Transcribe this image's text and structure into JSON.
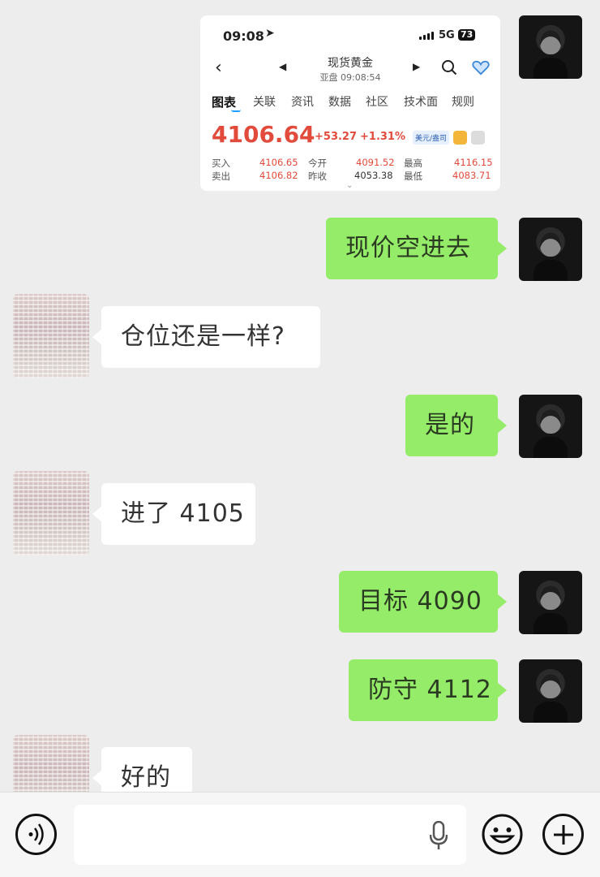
{
  "screenshot_card": {
    "status_time": "09:08",
    "status_location_arrow": "location-arrow-icon",
    "status_network": "5G",
    "status_battery": "73",
    "title": "现货黄金",
    "subtitle": "亚盘 09:08:54",
    "tabs": [
      "图表",
      "关联",
      "资讯",
      "数据",
      "社区",
      "技术面",
      "规则"
    ],
    "active_tab": "图表",
    "price": "4106.64",
    "change": "+53.27",
    "change_pct": "+1.31%",
    "currency_badge": "美元/盎司",
    "quotes": {
      "buy_label": "买入",
      "buy_value": "4106.65",
      "sell_label": "卖出",
      "sell_value": "4106.82",
      "open_label": "今开",
      "open_value": "4091.52",
      "prev_close_label": "昨收",
      "prev_close_value": "4053.38",
      "high_label": "最高",
      "high_value": "4116.15",
      "low_label": "最低",
      "low_value": "4083.71"
    }
  },
  "messages": [
    {
      "side": "self",
      "text": "现价空进去"
    },
    {
      "side": "other",
      "text": "仓位还是一样?"
    },
    {
      "side": "self",
      "text": "是的"
    },
    {
      "side": "other",
      "text": "进了 4105"
    },
    {
      "side": "self",
      "text": "目标 4090"
    },
    {
      "side": "self",
      "text": "防守 4112"
    },
    {
      "side": "other",
      "text": "好的"
    }
  ],
  "colors": {
    "self_bubble": "#95ec69",
    "other_bubble": "#ffffff",
    "chat_background": "#ededed",
    "price_red": "#e24a3b"
  },
  "input_bar": {
    "voice_icon": "voice-toggle-icon",
    "mic_icon": "microphone-icon",
    "emoji_icon": "emoji-icon",
    "plus_icon": "plus-icon",
    "text_value": ""
  }
}
